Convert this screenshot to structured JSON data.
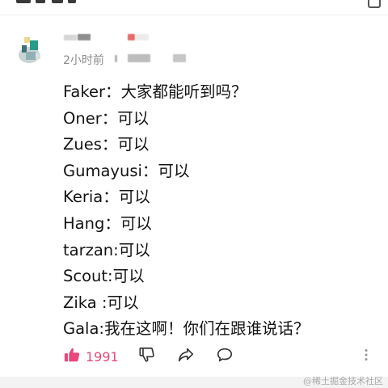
{
  "post": {
    "time_label": "2小时前",
    "comment_lines": [
      "Faker：大家都能听到吗？",
      "Oner：可以",
      "Zues：可以",
      "Gumayusi：可以",
      "Keria：可以",
      "Hang：可以",
      "tarzan:可以",
      "Scout:可以",
      "Zika :可以",
      "Gala:我在这啊！你们在跟谁说话？"
    ]
  },
  "actions": {
    "like_count": "1991"
  },
  "watermark": "@稀土掘金技术社区",
  "colors": {
    "accent": "#e8487b",
    "text": "#141414",
    "muted": "#8a8a8a"
  },
  "icons": [
    "thumbs-up-icon",
    "thumbs-down-icon",
    "share-icon",
    "comment-icon",
    "more-vertical-icon"
  ]
}
